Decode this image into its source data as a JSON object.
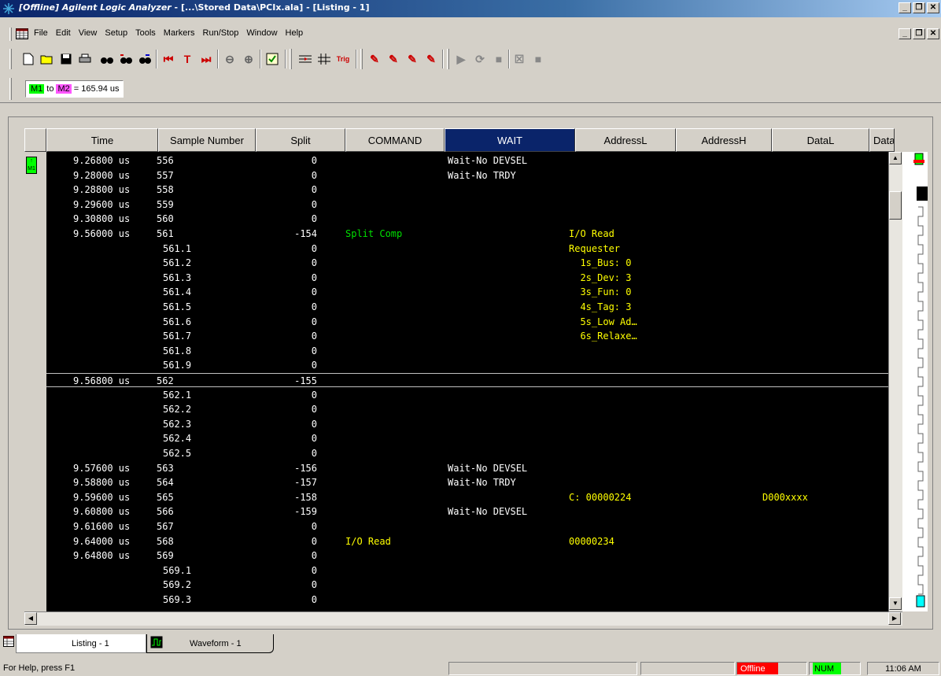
{
  "window": {
    "title_mode": "[Offline]",
    "title_app": "Agilent Logic Analyzer",
    "title_rest": "  - [...\\Stored Data\\PCIx.ala] - [Listing - 1]"
  },
  "menu": [
    "File",
    "Edit",
    "View",
    "Setup",
    "Tools",
    "Markers",
    "Run/Stop",
    "Window",
    "Help"
  ],
  "markers": {
    "m1": "M1",
    "to": "to",
    "m2": "M2",
    "value": "= 165.94 us"
  },
  "columns": [
    "Time",
    "Sample Number",
    "Split",
    "COMMAND",
    "WAIT",
    "AddressL",
    "AddressH",
    "DataL",
    "Data"
  ],
  "rows": [
    {
      "time": "9.26800 us",
      "sample": "556",
      "split": "0",
      "cmd": "",
      "wait": "Wait-No DEVSEL",
      "addrl": "",
      "datal": ""
    },
    {
      "time": "9.28000 us",
      "sample": "557",
      "split": "0",
      "cmd": "",
      "wait": "Wait-No TRDY",
      "addrl": "",
      "datal": ""
    },
    {
      "time": "9.28800 us",
      "sample": "558",
      "split": "0",
      "cmd": "",
      "wait": "",
      "addrl": "",
      "datal": ""
    },
    {
      "time": "9.29600 us",
      "sample": "559",
      "split": "0",
      "cmd": "",
      "wait": "",
      "addrl": "",
      "datal": ""
    },
    {
      "time": "9.30800 us",
      "sample": "560",
      "split": "0",
      "cmd": "",
      "wait": "",
      "addrl": "",
      "datal": ""
    },
    {
      "time": "9.56000 us",
      "sample": "561",
      "split": "-154",
      "cmd": "Split Comp",
      "wait": "",
      "addrl": "I/O Read",
      "datal": ""
    },
    {
      "time": "",
      "sample": "561.1",
      "split": "0",
      "cmd": "",
      "wait": "",
      "addrl": "Requester",
      "datal": ""
    },
    {
      "time": "",
      "sample": "561.2",
      "split": "0",
      "cmd": "",
      "wait": "",
      "addrl": "  1s_Bus: 0",
      "datal": ""
    },
    {
      "time": "",
      "sample": "561.3",
      "split": "0",
      "cmd": "",
      "wait": "",
      "addrl": "  2s_Dev: 3",
      "datal": ""
    },
    {
      "time": "",
      "sample": "561.4",
      "split": "0",
      "cmd": "",
      "wait": "",
      "addrl": "  3s_Fun: 0",
      "datal": ""
    },
    {
      "time": "",
      "sample": "561.5",
      "split": "0",
      "cmd": "",
      "wait": "",
      "addrl": "  4s_Tag: 3",
      "datal": ""
    },
    {
      "time": "",
      "sample": "561.6",
      "split": "0",
      "cmd": "",
      "wait": "",
      "addrl": "  5s_Low Ad…",
      "datal": ""
    },
    {
      "time": "",
      "sample": "561.7",
      "split": "0",
      "cmd": "",
      "wait": "",
      "addrl": "  6s_Relaxe…",
      "datal": ""
    },
    {
      "time": "",
      "sample": "561.8",
      "split": "0",
      "cmd": "",
      "wait": "",
      "addrl": "",
      "datal": ""
    },
    {
      "time": "",
      "sample": "561.9",
      "split": "0",
      "cmd": "",
      "wait": "",
      "addrl": "",
      "datal": ""
    },
    {
      "time": "9.56800 us",
      "sample": "562",
      "split": "-155",
      "cmd": "",
      "wait": "",
      "addrl": "",
      "datal": "",
      "marked": true
    },
    {
      "time": "",
      "sample": "562.1",
      "split": "0",
      "cmd": "",
      "wait": "",
      "addrl": "",
      "datal": ""
    },
    {
      "time": "",
      "sample": "562.2",
      "split": "0",
      "cmd": "",
      "wait": "",
      "addrl": "",
      "datal": ""
    },
    {
      "time": "",
      "sample": "562.3",
      "split": "0",
      "cmd": "",
      "wait": "",
      "addrl": "",
      "datal": ""
    },
    {
      "time": "",
      "sample": "562.4",
      "split": "0",
      "cmd": "",
      "wait": "",
      "addrl": "",
      "datal": ""
    },
    {
      "time": "",
      "sample": "562.5",
      "split": "0",
      "cmd": "",
      "wait": "",
      "addrl": "",
      "datal": ""
    },
    {
      "time": "9.57600 us",
      "sample": "563",
      "split": "-156",
      "cmd": "",
      "wait": "Wait-No DEVSEL",
      "addrl": "",
      "datal": ""
    },
    {
      "time": "9.58800 us",
      "sample": "564",
      "split": "-157",
      "cmd": "",
      "wait": "Wait-No TRDY",
      "addrl": "",
      "datal": ""
    },
    {
      "time": "9.59600 us",
      "sample": "565",
      "split": "-158",
      "cmd": "",
      "wait": "",
      "addrl": "C: 00000224",
      "datal": "D000xxxx"
    },
    {
      "time": "9.60800 us",
      "sample": "566",
      "split": "-159",
      "cmd": "",
      "wait": "Wait-No DEVSEL",
      "addrl": "",
      "datal": ""
    },
    {
      "time": "9.61600 us",
      "sample": "567",
      "split": "0",
      "cmd": "",
      "wait": "",
      "addrl": "",
      "datal": ""
    },
    {
      "time": "9.64000 us",
      "sample": "568",
      "split": "0",
      "cmd": "I/O Read",
      "wait": "",
      "addrl": "00000234",
      "datal": ""
    },
    {
      "time": "9.64800 us",
      "sample": "569",
      "split": "0",
      "cmd": "",
      "wait": "",
      "addrl": "",
      "datal": ""
    },
    {
      "time": "",
      "sample": "569.1",
      "split": "0",
      "cmd": "",
      "wait": "",
      "addrl": "",
      "datal": ""
    },
    {
      "time": "",
      "sample": "569.2",
      "split": "0",
      "cmd": "",
      "wait": "",
      "addrl": "",
      "datal": ""
    },
    {
      "time": "",
      "sample": "569.3",
      "split": "0",
      "cmd": "",
      "wait": "",
      "addrl": "",
      "datal": ""
    }
  ],
  "tabs": [
    "Listing - 1",
    "Waveform - 1"
  ],
  "status": {
    "help": "For Help, press F1",
    "offline": "Offline",
    "num": "NUM",
    "clock": "11:06 AM"
  },
  "gutter_marker": "M1",
  "colors": {
    "listing_bg": "#000000",
    "active_header": "#0a246a",
    "command_green": "#00e000",
    "decode_yellow": "#ffff00",
    "offline_red": "#ff0000",
    "num_green": "#00ff00"
  }
}
